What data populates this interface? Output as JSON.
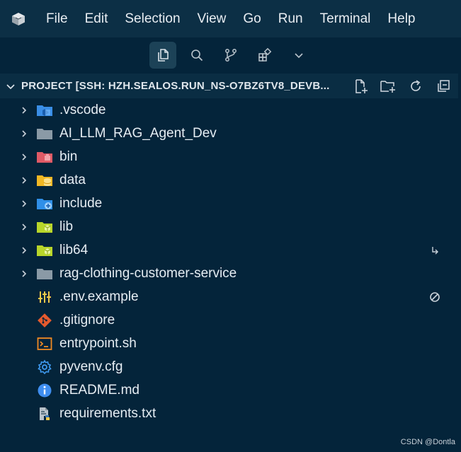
{
  "menubar": {
    "logo_icon": "vscode-remote-logo-icon",
    "items": [
      {
        "label": "File"
      },
      {
        "label": "Edit"
      },
      {
        "label": "Selection"
      },
      {
        "label": "View"
      },
      {
        "label": "Go"
      },
      {
        "label": "Run"
      },
      {
        "label": "Terminal"
      },
      {
        "label": "Help"
      }
    ]
  },
  "activity_toolbar": {
    "items": [
      {
        "icon": "explorer-files-icon",
        "active": true
      },
      {
        "icon": "search-icon",
        "active": false
      },
      {
        "icon": "source-control-icon",
        "active": false
      },
      {
        "icon": "extensions-icon",
        "active": false
      },
      {
        "icon": "chevron-down-icon",
        "active": false
      }
    ]
  },
  "explorer": {
    "section_title": "PROJECT [SSH: HZH.SEALOS.RUN_NS-O7BZ6TV8_DEVB...",
    "actions": [
      "new-file-icon",
      "new-folder-icon",
      "refresh-icon",
      "collapse-all-icon"
    ],
    "items": [
      {
        "label": ".vscode",
        "type": "folder",
        "icon": "folder-vscode-icon",
        "color": "#3a8ee6"
      },
      {
        "label": "AI_LLM_RAG_Agent_Dev",
        "type": "folder",
        "icon": "folder-icon",
        "color": "#8a9aa6"
      },
      {
        "label": "bin",
        "type": "folder",
        "icon": "folder-bin-icon",
        "color": "#e05a66"
      },
      {
        "label": "data",
        "type": "folder",
        "icon": "folder-database-icon",
        "color": "#f2b824"
      },
      {
        "label": "include",
        "type": "folder",
        "icon": "folder-include-icon",
        "color": "#2f8fe8"
      },
      {
        "label": "lib",
        "type": "folder",
        "icon": "folder-lib-icon",
        "color": "#b8d62a"
      },
      {
        "label": "lib64",
        "type": "folder",
        "icon": "folder-lib-icon",
        "color": "#b8d62a",
        "decoration": "symlink-arrow-icon"
      },
      {
        "label": "rag-clothing-customer-service",
        "type": "folder",
        "icon": "folder-icon",
        "color": "#8a9aa6"
      },
      {
        "label": ".env.example",
        "type": "file",
        "icon": "settings-tune-icon",
        "color": "#f0c94a",
        "decoration": "ignored-circle-slash-icon"
      },
      {
        "label": ".gitignore",
        "type": "file",
        "icon": "git-icon",
        "color": "#e65a2e"
      },
      {
        "label": "entrypoint.sh",
        "type": "file",
        "icon": "terminal-icon",
        "color": "#f08a24"
      },
      {
        "label": "pyvenv.cfg",
        "type": "file",
        "icon": "gear-icon",
        "color": "#3f9af0"
      },
      {
        "label": "README.md",
        "type": "file",
        "icon": "info-icon",
        "color": "#3f8ef0"
      },
      {
        "label": "requirements.txt",
        "type": "file",
        "icon": "python-requirements-icon",
        "color": "#3d7ab8"
      }
    ]
  },
  "watermark": "CSDN @Dontla"
}
